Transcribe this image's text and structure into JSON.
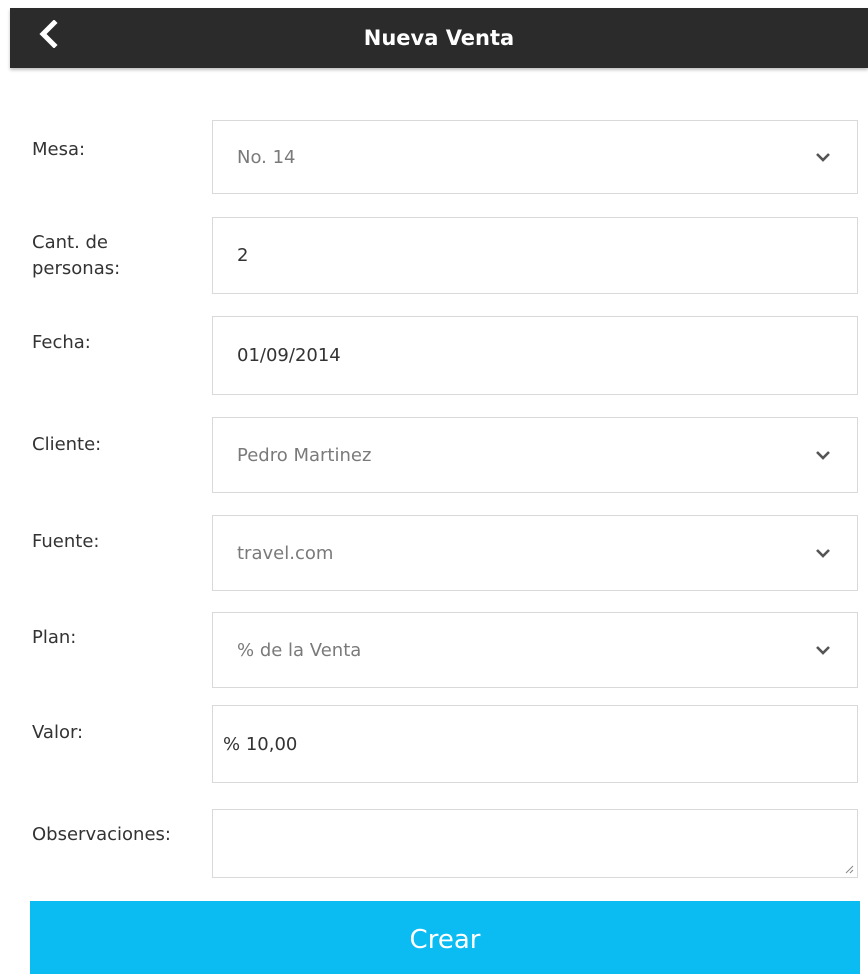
{
  "header": {
    "title": "Nueva Venta",
    "back_icon": "chevron-left-icon"
  },
  "form": {
    "mesa": {
      "label": "Mesa:",
      "value": "No. 14"
    },
    "personas": {
      "label_line1": "Cant. de",
      "label_line2": "personas:",
      "value": "2"
    },
    "fecha": {
      "label": "Fecha:",
      "value": "01/09/2014"
    },
    "cliente": {
      "label": "Cliente:",
      "value": "Pedro Martinez"
    },
    "fuente": {
      "label": "Fuente:",
      "value": "travel.com"
    },
    "plan": {
      "label": "Plan:",
      "value": "% de la Venta"
    },
    "valor": {
      "label": "Valor:",
      "value": "% 10,00"
    },
    "observaciones": {
      "label": "Observaciones:",
      "value": ""
    }
  },
  "actions": {
    "create_label": "Crear"
  },
  "colors": {
    "header_bg": "#2b2b2b",
    "accent": "#0bbcf2",
    "border": "#d9d9d9"
  }
}
